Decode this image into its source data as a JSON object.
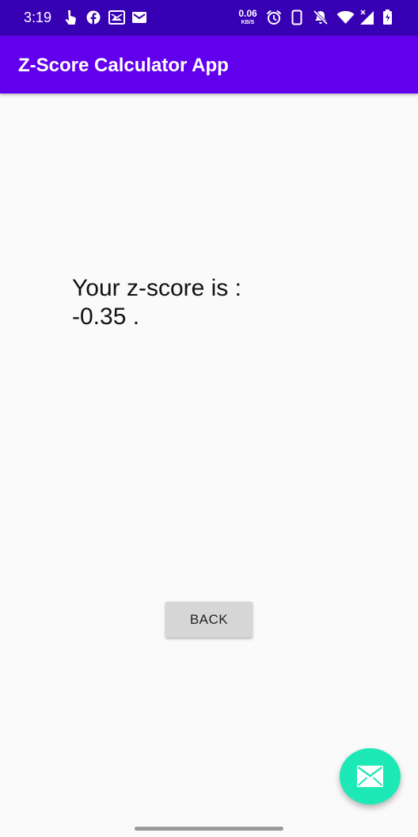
{
  "status_bar": {
    "time": "3:19",
    "net_speed_value": "0.06",
    "net_speed_unit": "KB/S",
    "icons": [
      "touch-icon",
      "facebook-icon",
      "gallery-mail-icon",
      "gmail-icon",
      "alarm-icon",
      "phone-outline-icon",
      "notifications-off-icon",
      "wifi-icon",
      "signal-icon",
      "battery-charging-icon"
    ],
    "color": "#3700b3"
  },
  "app_bar": {
    "title": "Z-Score Calculator App",
    "color": "#6200ee"
  },
  "result": {
    "line1": "Your z-score is :",
    "line2": "-0.35 ."
  },
  "back_button": {
    "label": "BACK"
  },
  "fab": {
    "icon": "mail-icon",
    "color": "#1de9b6"
  }
}
